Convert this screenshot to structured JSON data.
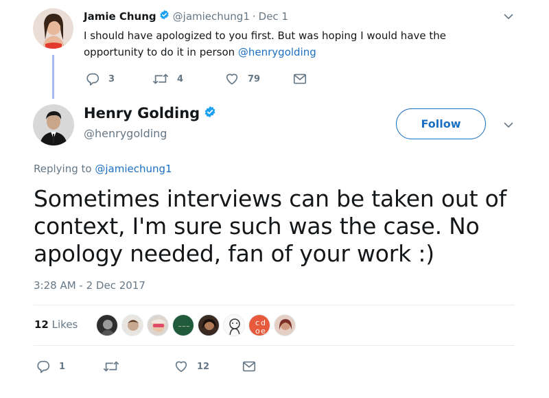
{
  "parent_tweet": {
    "author_name": "Jamie Chung",
    "handle": "@jamiechung1",
    "separator": "·",
    "date": "Dec 1",
    "text_plain": "I should have apologized to you first. But was hoping I would have the opportunity to do it in person ",
    "text_mention": "@henrygolding",
    "reply_count": "3",
    "retweet_count": "4",
    "like_count": "79"
  },
  "main_tweet": {
    "author_name": "Henry Golding",
    "handle": "@henrygolding",
    "follow_label": "Follow",
    "replying_prefix": "Replying to ",
    "replying_handle": "@jamiechung1",
    "text": "Sometimes interviews can be taken out of context, I'm sure such was the case. No apology needed, fan of your work :)",
    "timestamp": "3:28 AM - 2 Dec 2017",
    "likes_count": "12",
    "likes_label": " Likes",
    "reply_count": "1",
    "retweet_count": "",
    "like_count": "12"
  },
  "likers": [
    {
      "name": "liker-avatar-1",
      "color": "#3a3a3a"
    },
    {
      "name": "liker-avatar-2",
      "color": "#c8a890"
    },
    {
      "name": "liker-avatar-3",
      "color": "#d9d0c8"
    },
    {
      "name": "liker-avatar-4",
      "color": "#1f5a3a"
    },
    {
      "name": "liker-avatar-5",
      "color": "#4a2f25"
    },
    {
      "name": "liker-avatar-6",
      "color": "#f2f2f2"
    },
    {
      "name": "liker-avatar-7",
      "color": "#e85a3c"
    },
    {
      "name": "liker-avatar-8",
      "color": "#c98a7a"
    }
  ],
  "colors": {
    "accent": "#1b6fc2",
    "verified": "#1da1f2",
    "secondary_text": "#657786",
    "thread_line": "#aab8f2",
    "divider": "#e6ecf0"
  },
  "icons": {
    "reply": "reply-icon",
    "retweet": "retweet-icon",
    "like": "heart-icon",
    "dm": "envelope-icon",
    "verified": "verified-badge-icon",
    "menu": "chevron-down-icon"
  }
}
